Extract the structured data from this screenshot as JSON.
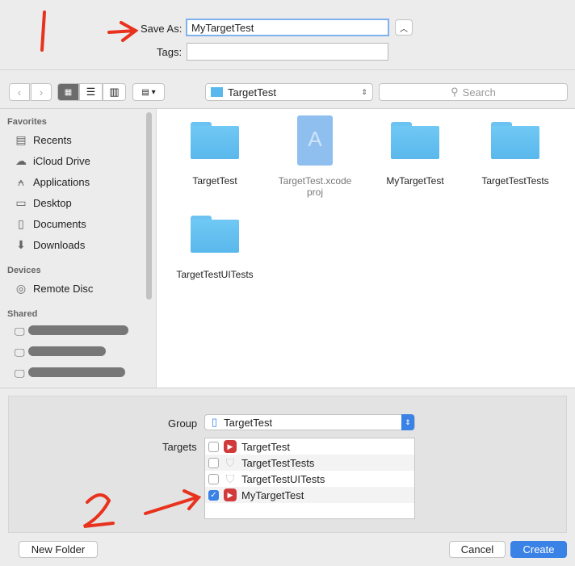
{
  "save_as": {
    "label": "Save As:",
    "value": "MyTargetTest"
  },
  "tags": {
    "label": "Tags:",
    "value": ""
  },
  "toolbar": {
    "location": "TargetTest",
    "search_placeholder": "Search"
  },
  "sidebar": {
    "favorites_header": "Favorites",
    "favorites": [
      {
        "label": "Recents",
        "icon": "recents-icon"
      },
      {
        "label": "iCloud Drive",
        "icon": "cloud-icon"
      },
      {
        "label": "Applications",
        "icon": "applications-icon"
      },
      {
        "label": "Desktop",
        "icon": "desktop-icon"
      },
      {
        "label": "Documents",
        "icon": "documents-icon"
      },
      {
        "label": "Downloads",
        "icon": "downloads-icon"
      }
    ],
    "devices_header": "Devices",
    "devices": [
      {
        "label": "Remote Disc",
        "icon": "disc-icon"
      }
    ],
    "shared_header": "Shared"
  },
  "files": [
    {
      "name": "TargetTest",
      "kind": "folder"
    },
    {
      "name": "TargetTest.xcode\nproj",
      "kind": "xcodeproj"
    },
    {
      "name": "MyTargetTest",
      "kind": "folder"
    },
    {
      "name": "TargetTestTests",
      "kind": "folder"
    },
    {
      "name": "TargetTestUITests",
      "kind": "folder"
    }
  ],
  "options": {
    "group_label": "Group",
    "group_value": "TargetTest",
    "targets_label": "Targets",
    "targets": [
      {
        "name": "TargetTest",
        "checked": false,
        "icon": "app-target-icon"
      },
      {
        "name": "TargetTestTests",
        "checked": false,
        "icon": "test-target-icon"
      },
      {
        "name": "TargetTestUITests",
        "checked": false,
        "icon": "test-target-icon"
      },
      {
        "name": "MyTargetTest",
        "checked": true,
        "icon": "app-target-icon"
      }
    ]
  },
  "footer": {
    "new_folder": "New Folder",
    "cancel": "Cancel",
    "create": "Create"
  },
  "annotations": {
    "one": "1",
    "two": "2"
  },
  "colors": {
    "accent": "#3b82e6",
    "annotation": "#e8321e",
    "folder": "#5ab8ec"
  }
}
